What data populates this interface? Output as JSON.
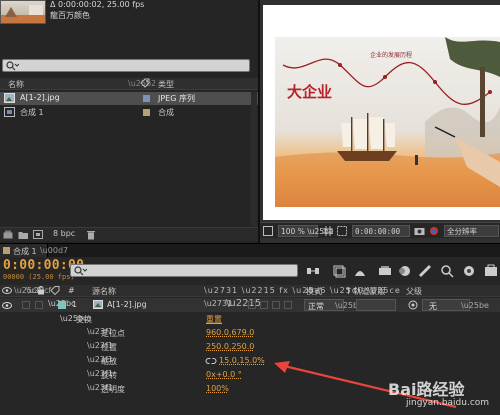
{
  "project": {
    "comp_info": "Δ 0:00:00:02, 25.00 fps",
    "comp_subinfo": "龍百万颜色",
    "columns": {
      "name": "名称",
      "type": "类型"
    },
    "items": [
      {
        "name": "A[1-2].jpg",
        "type": "JPEG 序列",
        "color": "#7e93b5",
        "selected": true
      },
      {
        "name": "合成 1",
        "type": "合成",
        "color": "#b8a070",
        "selected": false
      }
    ],
    "bit_depth": "8 bpc"
  },
  "viewer": {
    "zoom": "100 %",
    "timecode": "0:00:00:00",
    "resolution": "全分辨率",
    "artwork_text": {
      "headline": "大企业",
      "development": "企业的发展历程"
    }
  },
  "timeline": {
    "tab_label": "合成 1",
    "timecode": "0:00:00:00",
    "frame_info": "00000 (25.00 fps)",
    "columns": {
      "num": "#",
      "source": "源名称",
      "mode": "模式",
      "trkmat": "T   轨道蒙版",
      "parent": "父级"
    },
    "layer": {
      "index": "1",
      "name": "A[1-2].jpg",
      "mode": "正常",
      "parent": "无"
    },
    "transform": {
      "label": "变换",
      "reset": "重置"
    },
    "properties": [
      {
        "name": "定位点",
        "value": "960.0,679.0"
      },
      {
        "name": "位置",
        "value": "250.0,250.0"
      },
      {
        "name": "缩放",
        "value": "15.0,15.0%"
      },
      {
        "name": "旋转",
        "value": "0x+0.0 °"
      },
      {
        "name": "透明度",
        "value": "100%"
      }
    ]
  },
  "watermark": {
    "brand": "Bai路经验",
    "url": "jingyan.baidu.com"
  },
  "colors": {
    "accent": "#e3a23c",
    "arrow": "#e8453c",
    "label_blue": "#7e93b5",
    "label_tan": "#b8a070"
  }
}
